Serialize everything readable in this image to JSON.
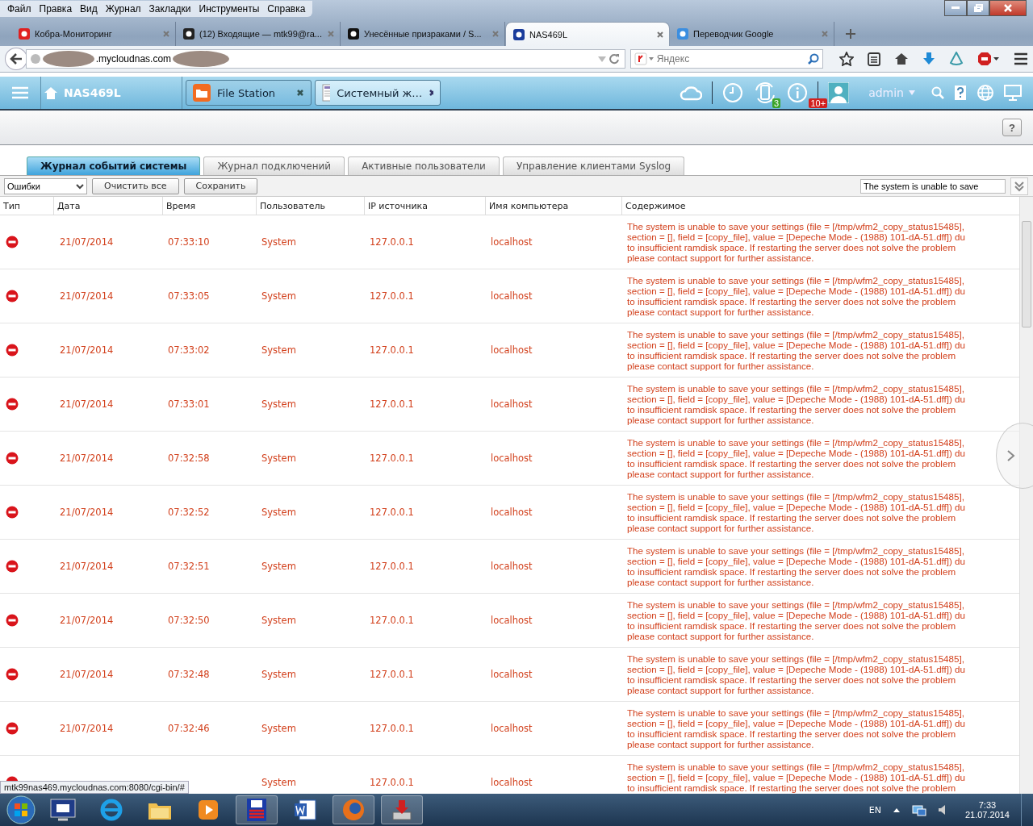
{
  "menu_bar": [
    "Файл",
    "Правка",
    "Вид",
    "Журнал",
    "Закладки",
    "Инструменты",
    "Справка"
  ],
  "browser_tabs": [
    {
      "title": "Кобра-Мониторинг",
      "selected": false
    },
    {
      "title": "(12) Входящие — mtk99@ra...",
      "selected": false
    },
    {
      "title": "Унесённые призраками / S...",
      "selected": false
    },
    {
      "title": "NAS469L",
      "selected": true
    },
    {
      "title": "Переводчик Google",
      "selected": false
    }
  ],
  "address_bar": {
    "url": ".mycloudnas.com"
  },
  "search_field": {
    "placeholder": "Яндекс"
  },
  "app_header": {
    "title": "NAS469L",
    "tabs": [
      {
        "label": "File Station",
        "selected": false
      },
      {
        "label": "Системный ж…",
        "selected": true
      }
    ],
    "sync_count": "3",
    "info_count": "10+",
    "user": "admin"
  },
  "help_button": "?",
  "log_tabs": [
    {
      "label": "Журнал событий системы",
      "selected": true
    },
    {
      "label": "Журнал подключений",
      "selected": false
    },
    {
      "label": "Активные пользователи",
      "selected": false
    },
    {
      "label": "Управление клиентами Syslog",
      "selected": false
    }
  ],
  "toolbar": {
    "filter": "Ошибки",
    "buttons": [
      "Очистить все",
      "Сохранить"
    ],
    "search_value": "The system is unable to save"
  },
  "table": {
    "columns": [
      "Тип",
      "Дата",
      "Время",
      "Пользователь",
      "IP источника",
      "Имя компьютера",
      "Содержимое"
    ],
    "rows": [
      {
        "date": "21/07/2014",
        "time": "07:33:10",
        "user": "System",
        "ip": "127.0.0.1",
        "host": "localhost",
        "content": [
          "The system is unable to save your settings (file = [/tmp/wfm2_copy_status15485],",
          "section = [], field = [copy_file], value = [Depeche Mode - (1988) 101-dA-51.dff]) du",
          "to insufficient ramdisk space. If restarting the server does not solve the problem",
          "please contact support for further assistance."
        ]
      },
      {
        "date": "21/07/2014",
        "time": "07:33:05",
        "user": "System",
        "ip": "127.0.0.1",
        "host": "localhost",
        "content": [
          "The system is unable to save your settings (file = [/tmp/wfm2_copy_status15485],",
          "section = [], field = [copy_file], value = [Depeche Mode - (1988) 101-dA-51.dff]) du",
          "to insufficient ramdisk space. If restarting the server does not solve the problem",
          "please contact support for further assistance."
        ]
      },
      {
        "date": "21/07/2014",
        "time": "07:33:02",
        "user": "System",
        "ip": "127.0.0.1",
        "host": "localhost",
        "content": [
          "The system is unable to save your settings (file = [/tmp/wfm2_copy_status15485],",
          "section = [], field = [copy_file], value = [Depeche Mode - (1988) 101-dA-51.dff]) du",
          "to insufficient ramdisk space. If restarting the server does not solve the problem",
          "please contact support for further assistance."
        ]
      },
      {
        "date": "21/07/2014",
        "time": "07:33:01",
        "user": "System",
        "ip": "127.0.0.1",
        "host": "localhost",
        "content": [
          "The system is unable to save your settings (file = [/tmp/wfm2_copy_status15485],",
          "section = [], field = [copy_file], value = [Depeche Mode - (1988) 101-dA-51.dff]) du",
          "to insufficient ramdisk space. If restarting the server does not solve the problem",
          "please contact support for further assistance."
        ]
      },
      {
        "date": "21/07/2014",
        "time": "07:32:58",
        "user": "System",
        "ip": "127.0.0.1",
        "host": "localhost",
        "content": [
          "The system is unable to save your settings (file = [/tmp/wfm2_copy_status15485],",
          "section = [], field = [copy_file], value = [Depeche Mode - (1988) 101-dA-51.dff]) du",
          "to insufficient ramdisk space. If restarting the server does not solve the problem",
          "please contact support for further assistance."
        ]
      },
      {
        "date": "21/07/2014",
        "time": "07:32:52",
        "user": "System",
        "ip": "127.0.0.1",
        "host": "localhost",
        "content": [
          "The system is unable to save your settings (file = [/tmp/wfm2_copy_status15485],",
          "section = [], field = [copy_file], value = [Depeche Mode - (1988) 101-dA-51.dff]) du",
          "to insufficient ramdisk space. If restarting the server does not solve the problem",
          "please contact support for further assistance."
        ]
      },
      {
        "date": "21/07/2014",
        "time": "07:32:51",
        "user": "System",
        "ip": "127.0.0.1",
        "host": "localhost",
        "content": [
          "The system is unable to save your settings (file = [/tmp/wfm2_copy_status15485],",
          "section = [], field = [copy_file], value = [Depeche Mode - (1988) 101-dA-51.dff]) du",
          "to insufficient ramdisk space. If restarting the server does not solve the problem",
          "please contact support for further assistance."
        ]
      },
      {
        "date": "21/07/2014",
        "time": "07:32:50",
        "user": "System",
        "ip": "127.0.0.1",
        "host": "localhost",
        "content": [
          "The system is unable to save your settings (file = [/tmp/wfm2_copy_status15485],",
          "section = [], field = [copy_file], value = [Depeche Mode - (1988) 101-dA-51.dff]) du",
          "to insufficient ramdisk space. If restarting the server does not solve the problem",
          "please contact support for further assistance."
        ]
      },
      {
        "date": "21/07/2014",
        "time": "07:32:48",
        "user": "System",
        "ip": "127.0.0.1",
        "host": "localhost",
        "content": [
          "The system is unable to save your settings (file = [/tmp/wfm2_copy_status15485],",
          "section = [], field = [copy_file], value = [Depeche Mode - (1988) 101-dA-51.dff]) du",
          "to insufficient ramdisk space. If restarting the server does not solve the problem",
          "please contact support for further assistance."
        ]
      },
      {
        "date": "21/07/2014",
        "time": "07:32:46",
        "user": "System",
        "ip": "127.0.0.1",
        "host": "localhost",
        "content": [
          "The system is unable to save your settings (file = [/tmp/wfm2_copy_status15485],",
          "section = [], field = [copy_file], value = [Depeche Mode - (1988) 101-dA-51.dff]) du",
          "to insufficient ramdisk space. If restarting the server does not solve the problem",
          "please contact support for further assistance."
        ]
      },
      {
        "user": "System",
        "ip": "127.0.0.1",
        "host": "localhost",
        "content": [
          "The system is unable to save your settings (file = [/tmp/wfm2_copy_status15485],",
          "section = [], field = [copy_file], value = [Depeche Mode - (1988) 101-dA-51.dff]) du",
          "to insufficient ramdisk space. If restarting the server does not solve the problem"
        ]
      }
    ]
  },
  "status_link": "mtk99nas469.mycloudnas.com:8080/cgi-bin/#",
  "taskbar": {
    "language": "EN",
    "time": "7:33",
    "date": "21.07.2014"
  }
}
